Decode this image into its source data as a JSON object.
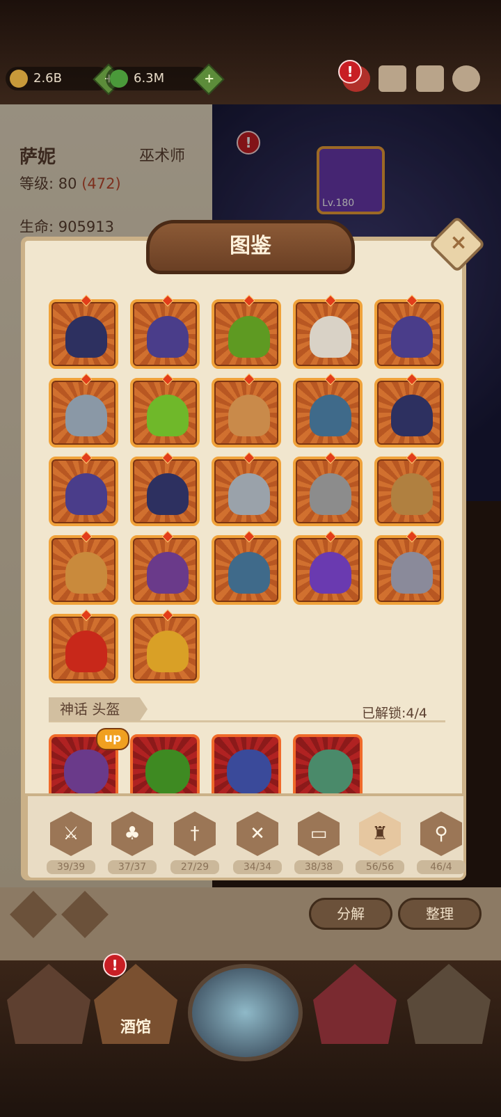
{
  "resources": [
    {
      "name": "gold",
      "value": "2.6B",
      "plus": "+"
    },
    {
      "name": "gem",
      "value": "6.3M",
      "plus": "+"
    }
  ],
  "alerts": {
    "top": "!",
    "hero": "!",
    "tavern": "!"
  },
  "character": {
    "name": "萨妮",
    "class": "巫术师",
    "level_label": "等级:",
    "level": "80",
    "level_extra": "(472)",
    "hp_label": "生命:",
    "hp": "905913"
  },
  "stage": {
    "hero_level": "Lv.180"
  },
  "modal": {
    "title": "图鉴",
    "close": "×"
  },
  "collection": {
    "items": [
      {
        "icon": "hood-icon",
        "color": "#2d3060"
      },
      {
        "icon": "wizard-hat-icon",
        "color": "#4a3d8a"
      },
      {
        "icon": "green-hood-icon",
        "color": "#5e9a22"
      },
      {
        "icon": "mask-icon",
        "color": "#d9d2c6"
      },
      {
        "icon": "wizard-hat-icon",
        "color": "#4a3d8a"
      },
      {
        "icon": "steel-helmet-icon",
        "color": "#8a98a6"
      },
      {
        "icon": "green-hood-icon",
        "color": "#6fb82a"
      },
      {
        "icon": "circlet-icon",
        "color": "#c98a4a"
      },
      {
        "icon": "fur-helmet-icon",
        "color": "#3f6a8a"
      },
      {
        "icon": "hood-icon",
        "color": "#2d3060"
      },
      {
        "icon": "wizard-hat-icon",
        "color": "#4a3d8a"
      },
      {
        "icon": "hood-icon",
        "color": "#2d3060"
      },
      {
        "icon": "knight-helmet-icon",
        "color": "#9aa2aa"
      },
      {
        "icon": "great-helm-icon",
        "color": "#8c8c8c"
      },
      {
        "icon": "bronze-helmet-icon",
        "color": "#b08040"
      },
      {
        "icon": "feather-hat-icon",
        "color": "#c98a3c"
      },
      {
        "icon": "purple-hood-icon",
        "color": "#6a3a8a"
      },
      {
        "icon": "fur-helmet-icon",
        "color": "#3f6a8a"
      },
      {
        "icon": "witch-hat-icon",
        "color": "#6a3ab0"
      },
      {
        "icon": "visor-helmet-icon",
        "color": "#8a8a9a"
      },
      {
        "icon": "demon-helmet-icon",
        "color": "#c8281a"
      },
      {
        "icon": "horned-crown-icon",
        "color": "#d9a026"
      }
    ],
    "mythic_title": "神话 头盔",
    "unlocked": "已解锁:4/4",
    "mythic_items": [
      {
        "icon": "skull-hood-icon",
        "color": "#6a3a8a"
      },
      {
        "icon": "green-witch-hat-icon",
        "color": "#3e8a22"
      },
      {
        "icon": "crowned-helm-icon",
        "color": "#3a4a9a"
      },
      {
        "icon": "cauldron-helmet-icon",
        "color": "#4a8a6a"
      }
    ],
    "up_badge": "up"
  },
  "tabs": [
    {
      "icon": "sword-icon",
      "glyph": "⚔",
      "count": "39/39"
    },
    {
      "icon": "club-icon",
      "glyph": "♣",
      "count": "37/37"
    },
    {
      "icon": "dagger-icon",
      "glyph": "†",
      "count": "27/29"
    },
    {
      "icon": "shield-icon",
      "glyph": "✕",
      "count": "34/34"
    },
    {
      "icon": "book-icon",
      "glyph": "▭",
      "count": "38/38"
    },
    {
      "icon": "helmet-icon",
      "glyph": "♜",
      "count": "56/56"
    },
    {
      "icon": "staff-icon",
      "glyph": "⚲",
      "count": "46/4"
    }
  ],
  "actions": {
    "decompose": "分解",
    "sort": "整理"
  },
  "nav": {
    "tavern": "酒馆"
  }
}
